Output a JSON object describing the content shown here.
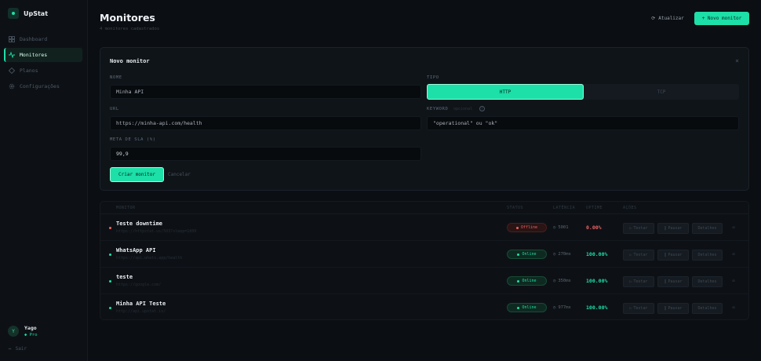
{
  "app": {
    "name": "UpStat"
  },
  "sidebar": {
    "items": [
      {
        "label": "Dashboard",
        "icon": "grid-icon",
        "active": false
      },
      {
        "label": "Monitores",
        "icon": "activity-icon",
        "active": true
      },
      {
        "label": "Planos",
        "icon": "diamond-icon",
        "active": false
      },
      {
        "label": "Configurações",
        "icon": "gear-icon",
        "active": false
      }
    ],
    "user": {
      "initial": "Y",
      "name": "Yago",
      "plan": "Pro"
    },
    "logout_label": "Sair"
  },
  "header": {
    "title": "Monitores",
    "subtitle": "4 monitores cadastrados",
    "refresh_label": "Atualizar",
    "new_label": "+ Novo monitor"
  },
  "form": {
    "title": "Novo monitor",
    "close_glyph": "×",
    "name_label": "NOME",
    "name_placeholder": "Minha API",
    "type_label": "TIPO",
    "type_options": [
      "HTTP",
      "TCP"
    ],
    "type_selected": "HTTP",
    "url_label": "URL",
    "url_placeholder": "https://minha-api.com/health",
    "keyword_label": "KEYWORD",
    "keyword_optional": "opcional",
    "keyword_placeholder": "\"operational\" ou \"ok\"",
    "sla_label": "META DE SLA (%)",
    "sla_value": "99,9",
    "create_label": "Criar monitor",
    "cancel_label": "Cancelar"
  },
  "table": {
    "headers": [
      "MONITOR",
      "STATUS",
      "LATÊNCIA",
      "UPTIME",
      "AÇÕES"
    ],
    "actions": {
      "test": "Testar",
      "pause": "Pausar",
      "details": "Detalhes"
    },
    "rows": [
      {
        "name": "Teste downtime",
        "url": "https://httpstat.us/503?sleep=1000",
        "status": "Offline",
        "latency": "5001",
        "uptime": "0.00%",
        "state": "offline"
      },
      {
        "name": "WhatsApp API",
        "url": "https://api.whats.app/health",
        "status": "Online",
        "latency": "270ms",
        "uptime": "100.00%",
        "state": "online"
      },
      {
        "name": "teste",
        "url": "https://google.com/",
        "status": "Online",
        "latency": "350ms",
        "uptime": "100.00%",
        "state": "online"
      },
      {
        "name": "Minha API Teste",
        "url": "http://api.upstat.io/",
        "status": "Online",
        "latency": "977ms",
        "uptime": "100.00%",
        "state": "online"
      }
    ]
  },
  "colors": {
    "accent": "#1ddfa8",
    "danger": "#f06262",
    "background": "#0b0e12"
  }
}
